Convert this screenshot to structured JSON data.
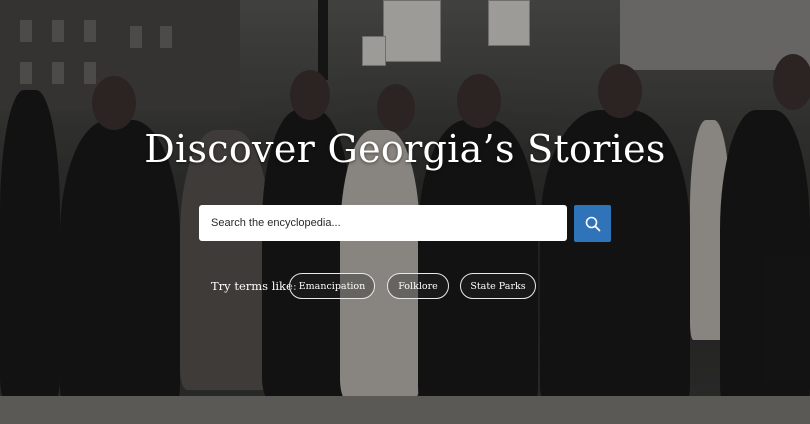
{
  "hero": {
    "title": "Discover Georgia’s Stories"
  },
  "search": {
    "placeholder": "Search the encyclopedia...",
    "button_icon": "search-icon",
    "button_color": "#2f74b8"
  },
  "suggestions": {
    "label": "Try terms like:",
    "terms": [
      "Emancipation",
      "Folklore",
      "State Parks"
    ]
  }
}
